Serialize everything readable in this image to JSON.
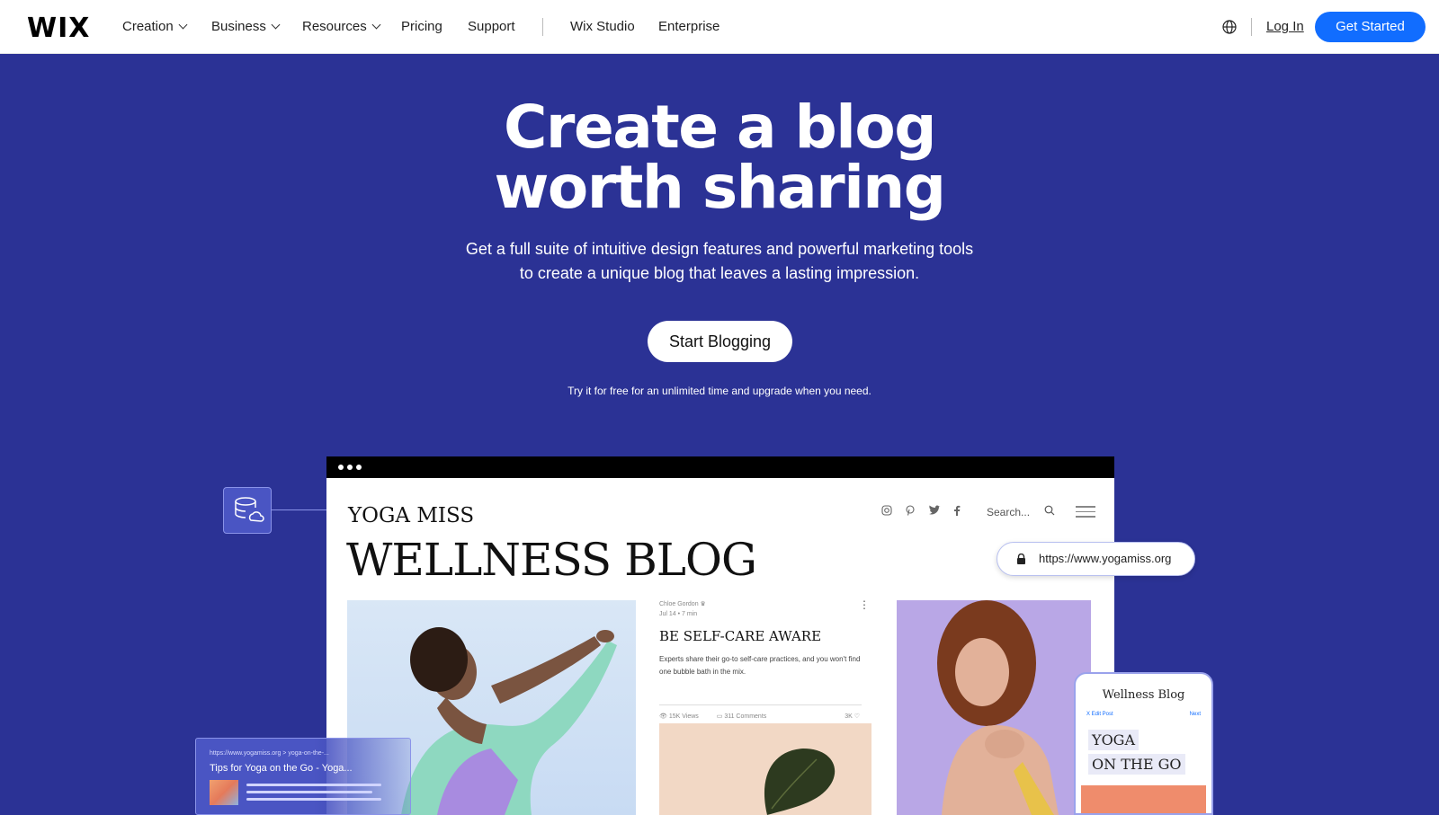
{
  "nav": {
    "logo": "WIX",
    "items": [
      {
        "label": "Creation"
      },
      {
        "label": "Business"
      },
      {
        "label": "Resources"
      },
      {
        "label": "Pricing"
      },
      {
        "label": "Support"
      },
      {
        "label": "Wix Studio"
      },
      {
        "label": "Enterprise"
      }
    ],
    "login": "Log In",
    "cta": "Get Started",
    "cta_color": "#116dff"
  },
  "hero": {
    "title_line1": "Create a blog",
    "title_line2": "worth sharing",
    "subtitle_line1": "Get a full suite of intuitive design features and powerful marketing tools",
    "subtitle_line2": "to create a unique blog that leaves a lasting impression.",
    "cta": "Start Blogging",
    "note": "Try it for free for an unlimited time and upgrade when you need.",
    "bg_color": "#2b3295"
  },
  "mockup": {
    "blog_name": "YOGA MISS",
    "blog_title": "WELLNESS BLOG",
    "search_placeholder": "Search...",
    "post": {
      "author": "Chloe Gordon ♛",
      "date": "Jul 14  •  7 min",
      "title": "BE SELF-CARE AWARE",
      "excerpt": "Experts share their go-to self-care practices, and you won't find one bubble bath in the mix.",
      "views": "15K Views",
      "comments": "311 Comments",
      "likes": "3K"
    },
    "url": "https://www.yogamiss.org",
    "phone": {
      "title": "Wellness Blog",
      "edit": "X  Edit Post",
      "next": "Next",
      "line1": "YOGA",
      "line2": "ON THE GO"
    },
    "serp": {
      "url": "https://www.yogamiss.org > yoga-on-the-...",
      "title": "Tips for Yoga on the Go - Yoga..."
    }
  }
}
